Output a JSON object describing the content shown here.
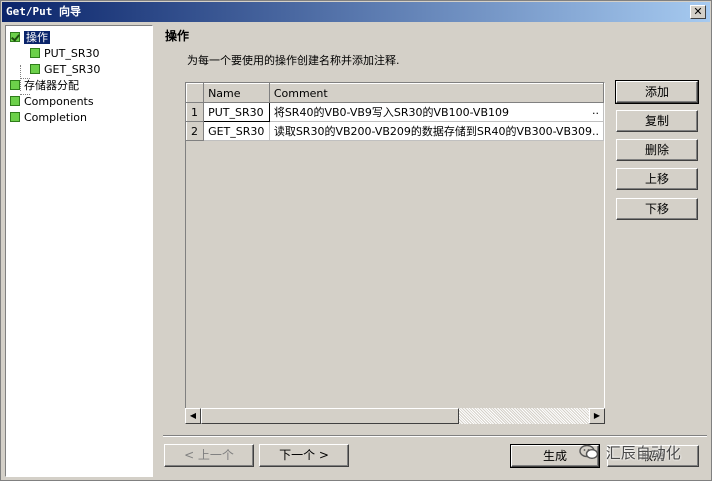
{
  "window": {
    "title": "Get/Put 向导",
    "close": "✕"
  },
  "tree": {
    "items": [
      {
        "label": "操作",
        "selected": true,
        "checked": true
      },
      {
        "label": "PUT_SR30"
      },
      {
        "label": "GET_SR30"
      },
      {
        "label": "存储器分配"
      },
      {
        "label": "Components"
      },
      {
        "label": "Completion"
      }
    ]
  },
  "main": {
    "heading": "操作",
    "description": "为每一个要使用的操作创建名称并添加注释."
  },
  "table": {
    "columns": [
      "Name",
      "Comment"
    ],
    "rows": [
      {
        "num": "1",
        "name": "PUT_SR30",
        "comment": "将SR40的VB0-VB9写入SR30的VB100-VB109",
        "trail": ".."
      },
      {
        "num": "2",
        "name": "GET_SR30",
        "comment": "读取SR30的VB200-VB209的数据存储到SR40的VB300-VB309..",
        "trail": ""
      }
    ]
  },
  "side_buttons": {
    "add": "添加",
    "copy": "复制",
    "delete": "删除",
    "move_up": "上移",
    "move_down": "下移"
  },
  "bottom_buttons": {
    "prev": "< 上一个",
    "next": "下一个 >",
    "generate": "生成",
    "cancel": "取消"
  },
  "watermark": "汇辰自动化",
  "colors": {
    "titlebar_start": "#0a246a",
    "titlebar_end": "#a6caf0",
    "check_green": "#6cd04a",
    "face": "#d4d0c8"
  }
}
